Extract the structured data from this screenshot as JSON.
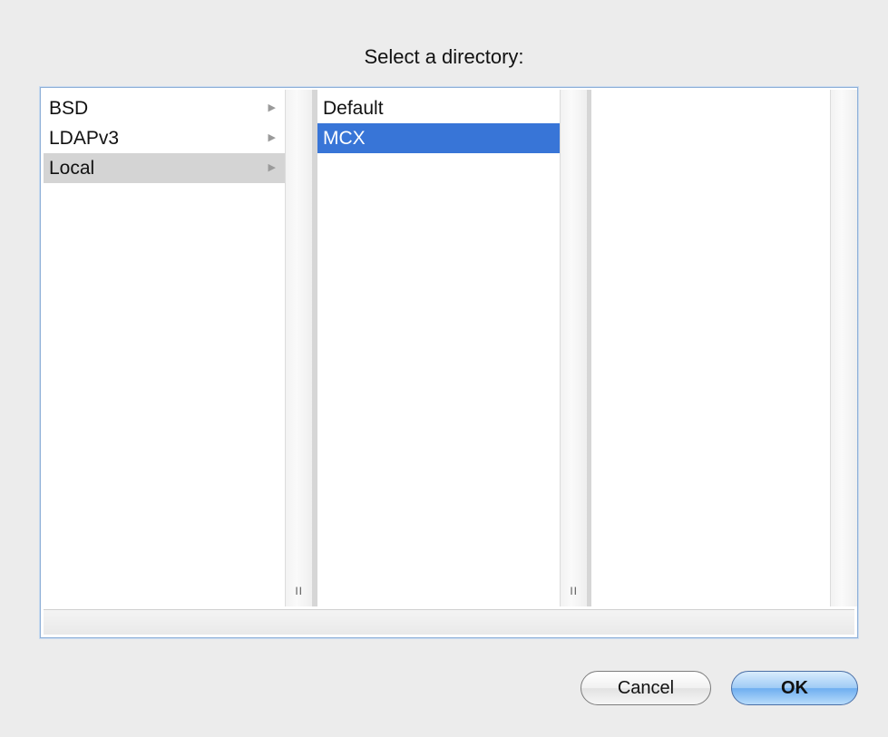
{
  "dialog": {
    "title": "Select a directory:"
  },
  "browser": {
    "column1": {
      "items": [
        {
          "label": "BSD",
          "arrow": "▶"
        },
        {
          "label": "LDAPv3",
          "arrow": "▶"
        },
        {
          "label": "Local",
          "arrow": "▶"
        }
      ],
      "grip": "II"
    },
    "column2": {
      "items": [
        {
          "label": "Default"
        },
        {
          "label": "MCX"
        }
      ],
      "grip": "II"
    },
    "column3": {
      "items": []
    }
  },
  "buttons": {
    "cancel_label": "Cancel",
    "ok_label": "OK"
  },
  "colors": {
    "selection_active": "#3875d7",
    "selection_inactive": "#d4d4d4",
    "background": "#ececec"
  }
}
